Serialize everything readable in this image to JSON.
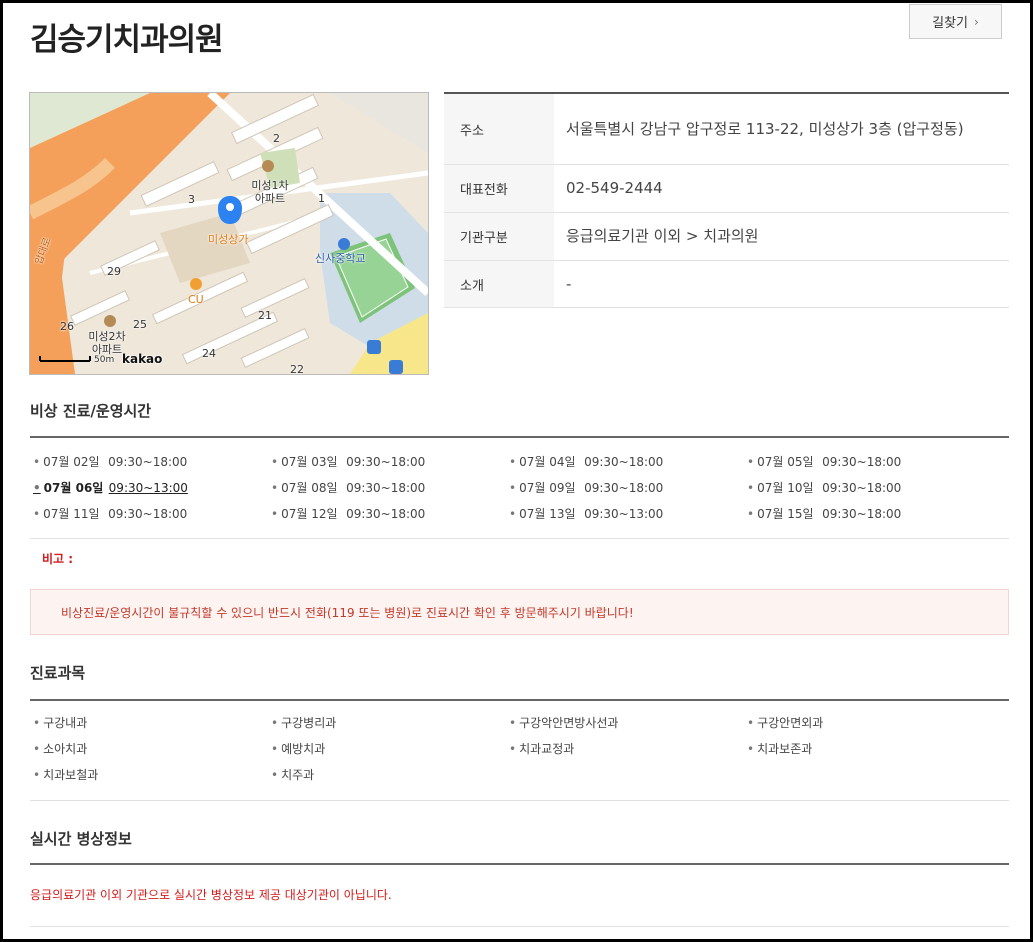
{
  "header": {
    "title": "김승기치과의원",
    "route_label": "길찾기"
  },
  "map": {
    "labels": [
      "미성상가",
      "미성1차 아파트",
      "신사중학교",
      "CU",
      "미성2차 아파트",
      "29",
      "26",
      "25",
      "24",
      "22",
      "21",
      "3",
      "2",
      "1",
      "압대로"
    ],
    "scale_text": "50m",
    "brand": "kakao"
  },
  "info": {
    "rows": [
      {
        "label": "주소",
        "value": "서울특별시 강남구 압구정로 113-22, 미성상가 3층 (압구정동)"
      },
      {
        "label": "대표전화",
        "value": "02-549-2444"
      },
      {
        "label": "기관구분",
        "value": "응급의료기관 이외 > 치과의원"
      },
      {
        "label": "소개",
        "value": "-"
      }
    ]
  },
  "hours": {
    "title": "비상 진료/운영시간",
    "entries": [
      {
        "date": "07월 02일",
        "time": "09:30~18:00"
      },
      {
        "date": "07월 03일",
        "time": "09:30~18:00"
      },
      {
        "date": "07월 04일",
        "time": "09:30~18:00"
      },
      {
        "date": "07월 05일",
        "time": "09:30~18:00"
      },
      {
        "date": "07월 06일",
        "time": "09:30~13:00"
      },
      {
        "date": "07월 08일",
        "time": "09:30~18:00"
      },
      {
        "date": "07월 09일",
        "time": "09:30~18:00"
      },
      {
        "date": "07월 10일",
        "time": "09:30~18:00"
      },
      {
        "date": "07월 11일",
        "time": "09:30~18:00"
      },
      {
        "date": "07월 12일",
        "time": "09:30~18:00"
      },
      {
        "date": "07월 13일",
        "time": "09:30~13:00"
      },
      {
        "date": "07월 15일",
        "time": "09:30~18:00"
      }
    ],
    "remark_label": "비고 :",
    "notice": "비상진료/운영시간이 불규칙할 수 있으니 반드시 전화(119 또는 병원)로 진료시간 확인 후 방문해주시기 바랍니다!"
  },
  "departments": {
    "title": "진료과목",
    "items": [
      "구강내과",
      "구강병리과",
      "구강악안면방사선과",
      "구강안면외과",
      "소아치과",
      "예방치과",
      "치과교정과",
      "치과보존과",
      "치과보철과",
      "치주과"
    ]
  },
  "beds": {
    "title": "실시간 병상정보",
    "note": "응급의료기관 이외 기관으로 실시간 병상정보 제공 대상기관이 아닙니다."
  }
}
